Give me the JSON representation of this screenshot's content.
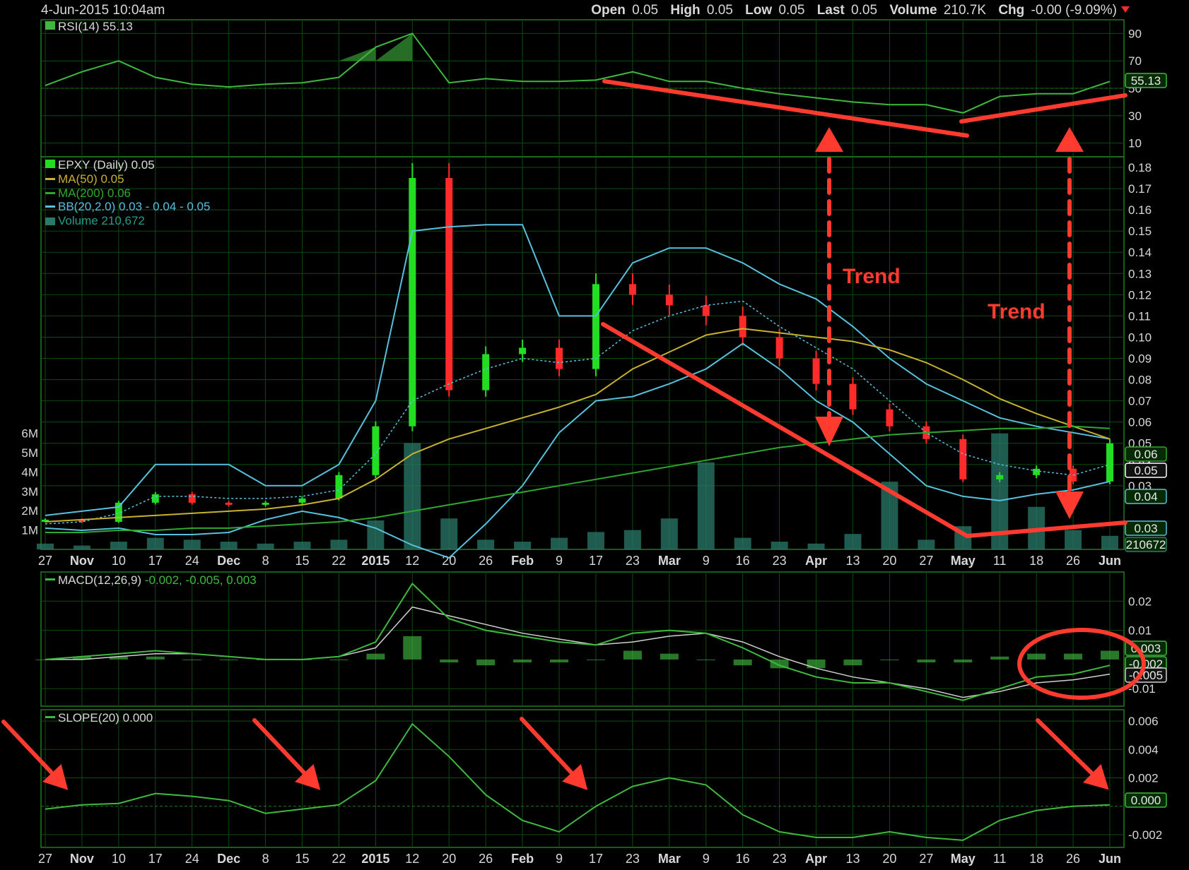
{
  "header": {
    "datetime": "4-Jun-2015 10:04am",
    "open_label": "Open",
    "open": "0.05",
    "high_label": "High",
    "high": "0.05",
    "low_label": "Low",
    "low": "0.05",
    "last_label": "Last",
    "last": "0.05",
    "volume_label": "Volume",
    "volume": "210.7K",
    "chg_label": "Chg",
    "chg": "-0.00 (-9.09%)"
  },
  "colors": {
    "background": "#000000",
    "grid": "#0f4a0f",
    "frame": "#1f7a1f",
    "green_line": "#3fb83f",
    "up_candle": "#22dd22",
    "down_candle": "#ff2a2a",
    "ma50": "#c8b030",
    "ma200": "#2fa82f",
    "bb": "#58c0dc",
    "volume": "#2a7a6a",
    "macd_signal": "#d0d0d0",
    "annotation": "#ff3b30",
    "label_text": "#d8d8d8"
  },
  "panels": {
    "rsi_legend": "RSI(14) 55.13",
    "rsi_value_box": "55.13",
    "price_legend": [
      "EPXY (Daily) 0.05",
      "MA(50) 0.05",
      "MA(200) 0.06",
      "BB(20,2.0) 0.03 - 0.04 - 0.05",
      "Volume 210,672"
    ],
    "price_value_boxes": [
      "0.06",
      "0.05",
      "0.04",
      "0.03",
      "210672"
    ],
    "macd_legend": "MACD(12,26,9)",
    "macd_legend_values": [
      "-0.002, -0.005,",
      "0.003"
    ],
    "macd_value_boxes": [
      "0.003",
      "-0.002",
      "-0.005"
    ],
    "slope_legend": "SLOPE(20) 0.000",
    "slope_value_box": "0.000"
  },
  "annotations": {
    "trend_labels": [
      "Trend",
      "Trend"
    ]
  },
  "chart_data": [
    {
      "type": "line",
      "panel": "RSI",
      "x": [
        "27",
        "Nov",
        "10",
        "17",
        "24",
        "Dec",
        "8",
        "15",
        "22",
        "2015",
        "12",
        "20",
        "26",
        "Feb",
        "9",
        "17",
        "23",
        "Mar",
        "9",
        "16",
        "23",
        "Apr",
        "13",
        "20",
        "27",
        "May",
        "11",
        "18",
        "26",
        "Jun"
      ],
      "series": [
        {
          "name": "RSI(14)",
          "values": [
            52,
            62,
            70,
            58,
            53,
            51,
            53,
            54,
            58,
            80,
            90,
            54,
            57,
            55,
            55,
            56,
            62,
            55,
            55,
            50,
            46,
            43,
            40,
            38,
            38,
            32,
            44,
            46,
            46,
            55
          ]
        }
      ],
      "yticks": [
        10,
        30,
        50,
        70,
        90
      ],
      "ylim": [
        0,
        100
      ]
    },
    {
      "type": "candlestick",
      "panel": "Price",
      "x": [
        "27",
        "Nov",
        "10",
        "17",
        "24",
        "Dec",
        "8",
        "15",
        "22",
        "2015",
        "12",
        "20",
        "26",
        "Feb",
        "9",
        "17",
        "23",
        "Mar",
        "9",
        "16",
        "23",
        "Apr",
        "13",
        "20",
        "27",
        "May",
        "11",
        "18",
        "26",
        "Jun"
      ],
      "series": [
        {
          "name": "EPXY (Daily)",
          "values": [
            0.014,
            0.013,
            0.022,
            0.026,
            0.022,
            0.021,
            0.022,
            0.024,
            0.035,
            0.058,
            0.175,
            0.075,
            0.092,
            0.095,
            0.085,
            0.125,
            0.12,
            0.115,
            0.11,
            0.1,
            0.09,
            0.078,
            0.066,
            0.058,
            0.052,
            0.033,
            0.035,
            0.038,
            0.032,
            0.05
          ]
        },
        {
          "name": "MA(50)",
          "values": [
            0.013,
            0.014,
            0.015,
            0.016,
            0.017,
            0.018,
            0.019,
            0.021,
            0.024,
            0.033,
            0.045,
            0.052,
            0.057,
            0.062,
            0.067,
            0.073,
            0.085,
            0.093,
            0.101,
            0.104,
            0.102,
            0.1,
            0.098,
            0.094,
            0.088,
            0.08,
            0.071,
            0.064,
            0.058,
            0.052
          ]
        },
        {
          "name": "MA(200)",
          "values": [
            0.008,
            0.008,
            0.009,
            0.009,
            0.01,
            0.01,
            0.011,
            0.012,
            0.013,
            0.015,
            0.018,
            0.021,
            0.024,
            0.027,
            0.03,
            0.033,
            0.036,
            0.039,
            0.042,
            0.045,
            0.048,
            0.05,
            0.052,
            0.054,
            0.055,
            0.056,
            0.057,
            0.057,
            0.058,
            0.057
          ]
        },
        {
          "name": "BB upper",
          "values": [
            0.016,
            0.018,
            0.02,
            0.04,
            0.04,
            0.04,
            0.03,
            0.03,
            0.04,
            0.07,
            0.15,
            0.152,
            0.153,
            0.153,
            0.11,
            0.11,
            0.135,
            0.142,
            0.142,
            0.135,
            0.125,
            0.118,
            0.105,
            0.09,
            0.078,
            0.07,
            0.062,
            0.058,
            0.055,
            0.052
          ]
        },
        {
          "name": "BB middle",
          "values": [
            0.012,
            0.013,
            0.017,
            0.025,
            0.025,
            0.024,
            0.024,
            0.025,
            0.028,
            0.045,
            0.07,
            0.078,
            0.085,
            0.09,
            0.088,
            0.09,
            0.103,
            0.11,
            0.115,
            0.117,
            0.105,
            0.095,
            0.085,
            0.07,
            0.055,
            0.045,
            0.04,
            0.037,
            0.035,
            0.04
          ]
        },
        {
          "name": "BB lower",
          "values": [
            0.01,
            0.009,
            0.01,
            0.007,
            0.007,
            0.008,
            0.014,
            0.018,
            0.015,
            0.01,
            0.002,
            -0.004,
            0.012,
            0.03,
            0.055,
            0.07,
            0.072,
            0.078,
            0.085,
            0.097,
            0.085,
            0.07,
            0.06,
            0.045,
            0.03,
            0.025,
            0.023,
            0.026,
            0.028,
            0.032
          ]
        }
      ],
      "yticks": [
        0.03,
        0.04,
        0.05,
        0.06,
        0.07,
        0.08,
        0.09,
        0.1,
        0.11,
        0.12,
        0.13,
        0.14,
        0.15,
        0.16,
        0.17,
        0.18
      ],
      "ylim": [
        0.0,
        0.185
      ]
    },
    {
      "type": "bar",
      "panel": "Volume",
      "x": [
        "27",
        "Nov",
        "10",
        "17",
        "24",
        "Dec",
        "8",
        "15",
        "22",
        "2015",
        "12",
        "20",
        "26",
        "Feb",
        "9",
        "17",
        "23",
        "Mar",
        "9",
        "16",
        "23",
        "Apr",
        "13",
        "20",
        "27",
        "May",
        "11",
        "18",
        "26",
        "Jun"
      ],
      "series": [
        {
          "name": "Volume",
          "values": [
            0.3,
            0.2,
            0.4,
            0.6,
            0.5,
            0.4,
            0.3,
            0.4,
            0.5,
            1.5,
            5.5,
            1.6,
            0.5,
            0.4,
            0.6,
            0.9,
            1.0,
            1.6,
            4.5,
            0.6,
            0.4,
            0.3,
            0.8,
            3.5,
            0.5,
            1.2,
            6.0,
            2.2,
            1.0,
            0.7
          ]
        }
      ],
      "yticks": [
        "1M",
        "2M",
        "3M",
        "4M",
        "5M",
        "6M"
      ],
      "ylim": [
        0,
        6.5
      ]
    },
    {
      "type": "line",
      "panel": "MACD",
      "x": [
        "27",
        "Nov",
        "10",
        "17",
        "24",
        "Dec",
        "8",
        "15",
        "22",
        "2015",
        "12",
        "20",
        "26",
        "Feb",
        "9",
        "17",
        "23",
        "Mar",
        "9",
        "16",
        "23",
        "Apr",
        "13",
        "20",
        "27",
        "May",
        "11",
        "18",
        "26",
        "Jun"
      ],
      "series": [
        {
          "name": "MACD",
          "values": [
            0.0,
            0.001,
            0.002,
            0.003,
            0.002,
            0.001,
            0.0,
            0.0,
            0.001,
            0.006,
            0.026,
            0.014,
            0.01,
            0.008,
            0.006,
            0.005,
            0.009,
            0.01,
            0.009,
            0.004,
            -0.002,
            -0.006,
            -0.008,
            -0.008,
            -0.011,
            -0.014,
            -0.01,
            -0.006,
            -0.005,
            -0.002
          ]
        },
        {
          "name": "Signal",
          "values": [
            0.0,
            0.0,
            0.001,
            0.002,
            0.002,
            0.001,
            0.0,
            0.0,
            0.001,
            0.004,
            0.018,
            0.015,
            0.012,
            0.009,
            0.007,
            0.005,
            0.006,
            0.008,
            0.009,
            0.006,
            0.001,
            -0.003,
            -0.006,
            -0.008,
            -0.01,
            -0.013,
            -0.011,
            -0.008,
            -0.007,
            -0.005
          ]
        },
        {
          "name": "Histogram",
          "values": [
            0.0,
            0.001,
            0.001,
            0.001,
            0.0,
            0.0,
            0.0,
            0.0,
            0.0,
            0.002,
            0.008,
            -0.001,
            -0.002,
            -0.001,
            -0.001,
            0.0,
            0.003,
            0.002,
            0.0,
            -0.002,
            -0.003,
            -0.003,
            -0.002,
            0.0,
            -0.001,
            -0.001,
            0.001,
            0.002,
            0.002,
            0.003
          ]
        }
      ],
      "yticks": [
        -0.01,
        0.01,
        0.02
      ],
      "ylim": [
        -0.016,
        0.03
      ]
    },
    {
      "type": "line",
      "panel": "SLOPE",
      "x": [
        "27",
        "Nov",
        "10",
        "17",
        "24",
        "Dec",
        "8",
        "15",
        "22",
        "2015",
        "12",
        "20",
        "26",
        "Feb",
        "9",
        "17",
        "23",
        "Mar",
        "9",
        "16",
        "23",
        "Apr",
        "13",
        "20",
        "27",
        "May",
        "11",
        "18",
        "26",
        "Jun"
      ],
      "series": [
        {
          "name": "SLOPE(20)",
          "values": [
            -0.0002,
            0.0001,
            0.0002,
            0.0009,
            0.0007,
            0.0004,
            -0.0005,
            -0.0002,
            0.0001,
            0.0018,
            0.0058,
            0.0035,
            0.0008,
            -0.001,
            -0.0018,
            0.0,
            0.0014,
            0.002,
            0.0015,
            -0.0006,
            -0.0018,
            -0.0022,
            -0.0022,
            -0.0018,
            -0.0022,
            -0.0024,
            -0.001,
            -0.0003,
            0.0,
            0.0001
          ]
        }
      ],
      "yticks": [
        -0.002,
        0.002,
        0.004,
        0.006
      ],
      "ylim": [
        -0.0029,
        0.0068
      ]
    }
  ]
}
